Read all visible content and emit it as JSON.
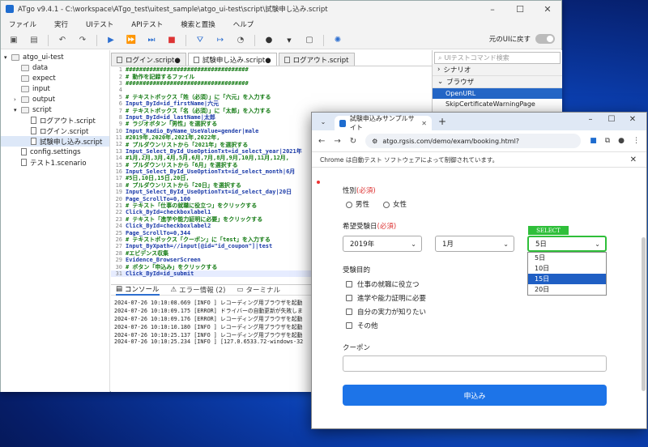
{
  "ide": {
    "title": "ATgo v9.4.1 - C:\\workspace\\ATgo_test\\uitest_sample\\atgo_ui-test\\script\\試験申し込み.script",
    "menu": [
      "ファイル",
      "実行",
      "UIテスト",
      "APIテスト",
      "検索と置換",
      "ヘルプ"
    ],
    "restore_label": "元のUIに戻す",
    "tree": [
      {
        "label": "atgo_ui-test",
        "level": 0,
        "type": "folder"
      },
      {
        "label": "data",
        "level": 1,
        "type": "folder"
      },
      {
        "label": "expect",
        "level": 1,
        "type": "folder"
      },
      {
        "label": "input",
        "level": 1,
        "type": "folder"
      },
      {
        "label": "output",
        "level": 1,
        "type": "folder"
      },
      {
        "label": "script",
        "level": 1,
        "type": "folder"
      },
      {
        "label": "ログアウト.script",
        "level": 2,
        "type": "file"
      },
      {
        "label": "ログイン.script",
        "level": 2,
        "type": "file"
      },
      {
        "label": "試験申し込み.script",
        "level": 2,
        "type": "file"
      },
      {
        "label": "config.settings",
        "level": 1,
        "type": "file"
      },
      {
        "label": "テスト1.scenario",
        "level": 1,
        "type": "file"
      }
    ],
    "tabs": [
      "ログイン.script●",
      "試験申し込み.script●",
      "ログアウト.script"
    ],
    "code": [
      {
        "n": "1",
        "t": "####################################",
        "k": "c"
      },
      {
        "n": "2",
        "t": "# 動作を記録するファイル",
        "k": "c"
      },
      {
        "n": "3",
        "t": "####################################",
        "k": "c"
      },
      {
        "n": "4",
        "t": "",
        "k": ""
      },
      {
        "n": "5",
        "t": "# テキストボックス「姓（必須）」に「六元」を入力する",
        "k": "c"
      },
      {
        "n": "6",
        "t": "Input_ById=id_firstName|六元",
        "k": "k"
      },
      {
        "n": "7",
        "t": "# テキストボックス「名（必須）」に「太郎」を入力する",
        "k": "c"
      },
      {
        "n": "8",
        "t": "Input_ById=id_lastName|太郎",
        "k": "k"
      },
      {
        "n": "9",
        "t": "# ラジオボタン「男性」を選択する",
        "k": "c"
      },
      {
        "n": "10",
        "t": "Input_Radio_ByName_UseValue=gender|male",
        "k": "k"
      },
      {
        "n": "11",
        "t": "#2019年,2020年,2021年,2022年,",
        "k": "c"
      },
      {
        "n": "12",
        "t": "# プルダウンリストから「2021年」を選択する",
        "k": "c"
      },
      {
        "n": "13",
        "t": "Input_Select_ById_UseOptionTxt=id_select_year|2021年",
        "k": "k"
      },
      {
        "n": "14",
        "t": "#1月,2月,3月,4月,5月,6月,7月,8月,9月,10月,11月,12月,",
        "k": "c"
      },
      {
        "n": "15",
        "t": "# プルダウンリストから「6月」を選択する",
        "k": "c"
      },
      {
        "n": "16",
        "t": "Input_Select_ById_UseOptionTxt=id_select_month|6月",
        "k": "k"
      },
      {
        "n": "17",
        "t": "#5日,10日,15日,20日,",
        "k": "c"
      },
      {
        "n": "18",
        "t": "# プルダウンリストから「20日」を選択する",
        "k": "c"
      },
      {
        "n": "19",
        "t": "Input_Select_ById_UseOptionTxt=id_select_day|20日",
        "k": "k"
      },
      {
        "n": "20",
        "t": "Page_ScrollTo=0,100",
        "k": "k"
      },
      {
        "n": "21",
        "t": "# テキスト「仕事の就職に役立つ」をクリックする",
        "k": "c"
      },
      {
        "n": "22",
        "t": "Click_ById=checkboxlabel1",
        "k": "k"
      },
      {
        "n": "23",
        "t": "# テキスト「進学や能力証明に必要」をクリックする",
        "k": "c"
      },
      {
        "n": "24",
        "t": "Click_ById=checkboxlabel2",
        "k": "k"
      },
      {
        "n": "25",
        "t": "Page_ScrollTo=0,344",
        "k": "k"
      },
      {
        "n": "26",
        "t": "# テキストボックス「クーポン」に「test」を入力する",
        "k": "c"
      },
      {
        "n": "27",
        "t": "Input_ByXpath=//input[@id=\"id_coupon\"]|test",
        "k": "k"
      },
      {
        "n": "28",
        "t": "#エビデンス収集",
        "k": "c"
      },
      {
        "n": "29",
        "t": "Evidence_BrowserScreen",
        "k": "k"
      },
      {
        "n": "30",
        "t": "# ボタン「申込み」をクリックする",
        "k": "c"
      },
      {
        "n": "31",
        "t": "Click_ById=id_submit",
        "k": "k"
      }
    ],
    "console_tabs": [
      "コンソール",
      "エラー情報 (2)",
      "ターミナル"
    ],
    "console": [
      "2024-07-26 10:10:08.669 [INFO ] レコーディング用ブラウザを起動",
      "2024-07-26 10:10:09.175 [ERROR] ドライバーの自動更新が失敗しま",
      "2024-07-26 10:10:09.176 [ERROR] レコーディング用ブラウザを起動",
      "2024-07-26 10:10:10.180 [INFO ] レコーディング用ブラウザを起動",
      "2024-07-26 10:10:25.137 [INFO ] レコーディング用ブラウザを起動",
      "2024-07-26 10:10:25.234 [INFO ] [127.0.6533.72-windows-32"
    ],
    "cmd_search_placeholder": "UIテストコマンド検索",
    "cmd_groups": [
      "シナリオ",
      "ブラウザ"
    ],
    "cmd_items": [
      "OpenURL",
      "SkipCertificateWarningPage"
    ]
  },
  "chrome": {
    "tab_title": "試験申込みサンプルサイト",
    "url": "atgo.rgsis.com/demo/exam/booking.html?",
    "infobar": "Chrome は自動テスト ソフトウェアによって制御されています。"
  },
  "form": {
    "gender_label": "性別",
    "required": "(必須)",
    "male": "男性",
    "female": "女性",
    "date_label": "希望受験日",
    "year": "2019年",
    "month": "1月",
    "day": "5日",
    "select_tag": "SELECT",
    "day_options": [
      "5日",
      "10日",
      "15日",
      "20日"
    ],
    "purpose_label": "受験目的",
    "purposes": [
      "仕事の就職に役立つ",
      "進学や能力証明に必要",
      "自分の実力が知りたい",
      "その他"
    ],
    "coupon_label": "クーポン",
    "submit_label": "申込み"
  }
}
